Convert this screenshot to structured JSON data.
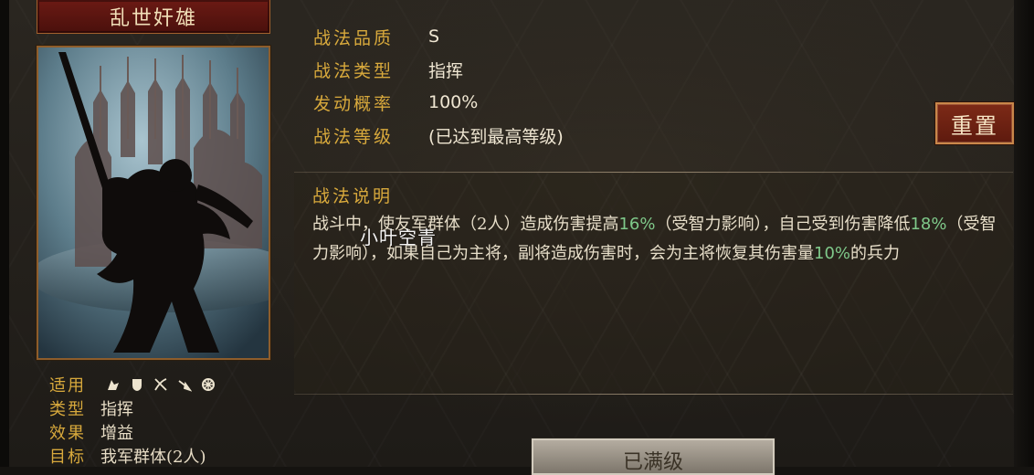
{
  "skill": {
    "name": "乱世奸雄",
    "quality_label": "战法品质",
    "quality_value": "S",
    "type_label": "战法类型",
    "type_value": "指挥",
    "rate_label": "发动概率",
    "rate_value": "100%",
    "level_label": "战法等级",
    "level_value": "(已达到最高等级)"
  },
  "reset_button": {
    "label": "重置"
  },
  "description": {
    "title": "战法说明",
    "seg1": "战斗中，使友军群体（2人）造成伤害提高",
    "val1": "16%",
    "seg2": "（受智力影响），自己受到伤害降低",
    "val2": "18%",
    "seg3": "（受智力影响），如果自己为主将，副将造成伤害时，会为主将恢复其伤害量",
    "val3": "10%",
    "seg4": "的兵力",
    "highlight_color": "#7fc98a"
  },
  "watermark": "小叶空青",
  "stats": {
    "applicable_label": "适用",
    "applicable_icons": [
      "cavalry-icon",
      "shield-icon",
      "bow-icon",
      "spear-icon",
      "wheel-icon"
    ],
    "class_label": "类型",
    "class_value": "指挥",
    "effect_label": "效果",
    "effect_value": "增益",
    "target_label": "目标",
    "target_value": "我军群体(2人)"
  },
  "max_button": {
    "label": "已满级"
  }
}
